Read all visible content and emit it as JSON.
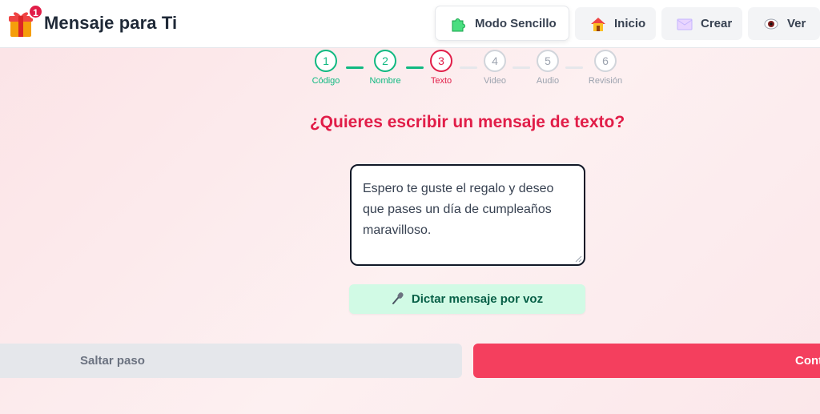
{
  "header": {
    "title": "Mensaje para Ti",
    "badge_count": "1",
    "nav": {
      "sencillo": {
        "label": "Modo Sencillo",
        "icon": "puzzle-icon"
      },
      "inicio": {
        "label": "Inicio",
        "icon": "house-icon"
      },
      "crear": {
        "label": "Crear",
        "icon": "envelope-icon"
      },
      "ver": {
        "label": "Ver",
        "icon": "eye-icon"
      }
    }
  },
  "stepper": {
    "steps": [
      {
        "number": "1",
        "label": "Código",
        "state": "done"
      },
      {
        "number": "2",
        "label": "Nombre",
        "state": "done"
      },
      {
        "number": "3",
        "label": "Texto",
        "state": "current"
      },
      {
        "number": "4",
        "label": "Video",
        "state": "pending"
      },
      {
        "number": "5",
        "label": "Audio",
        "state": "pending"
      },
      {
        "number": "6",
        "label": "Revisión",
        "state": "pending"
      }
    ]
  },
  "main": {
    "question": "¿Quieres escribir un mensaje de texto?",
    "message_value": "Espero te guste el regalo y deseo que pases un día de cumpleaños maravilloso.",
    "dictate_label": "Dictar mensaje por voz",
    "dictate_icon": "microphone-icon"
  },
  "footer": {
    "skip_label": "Saltar paso",
    "continue_label": "Continuar"
  },
  "colors": {
    "accent": "#e11d48",
    "success": "#10b981",
    "continue": "#f43f5e"
  }
}
